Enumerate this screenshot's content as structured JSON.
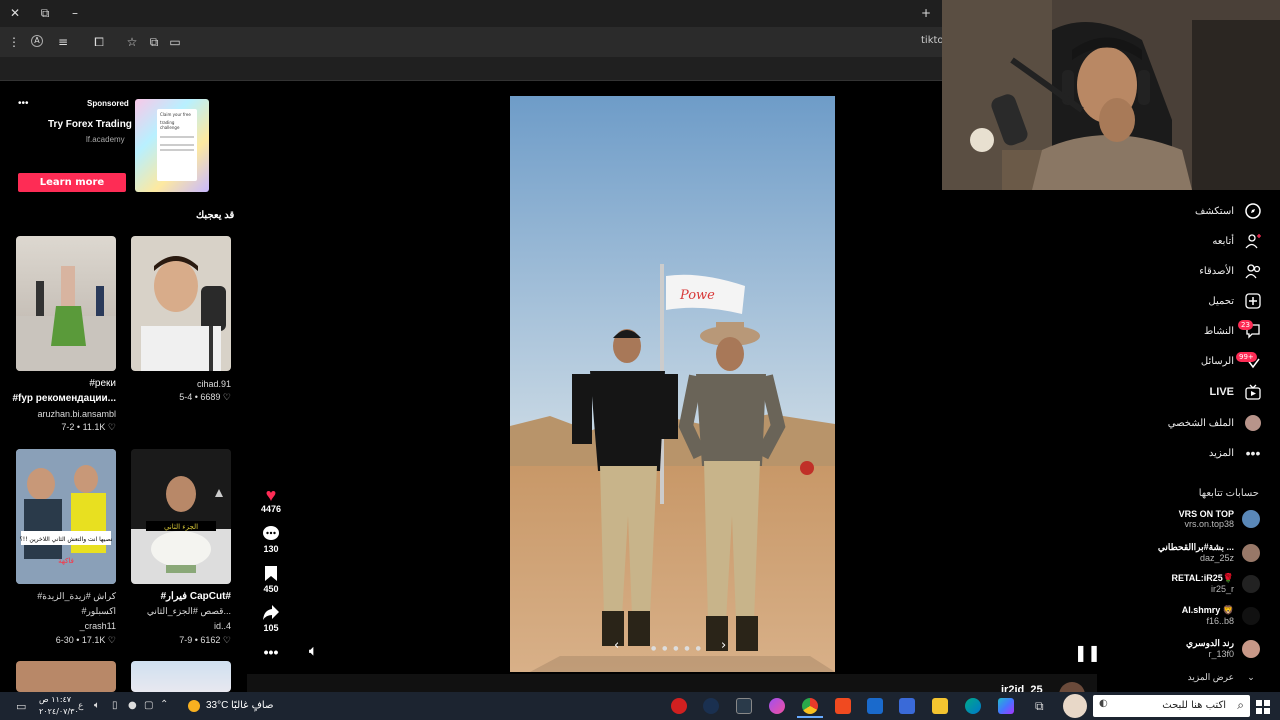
{
  "browser": {
    "url_fragment": "tiktol"
  },
  "ad": {
    "label": "Sponsored",
    "more_icon": "more-dots-icon",
    "title": "Try Forex Trading",
    "domain": "lf.academy",
    "cta": "Learn more",
    "thumb_lines": [
      "Claim your free",
      "trading challenge"
    ]
  },
  "recommendations": {
    "heading": "قد يعجبك",
    "items": [
      {
        "caption": "#реки",
        "caption2": "#fyp рекомендации...",
        "author": "aruzhan.bi.ansambl",
        "likes": "11.1K",
        "date": "7-2"
      },
      {
        "caption": "",
        "caption2": "",
        "author": "cihad.91",
        "likes": "6689",
        "date": "5-4"
      },
      {
        "caption": "#كراش #زيدة_الزيدة",
        "caption2": "#اكسبلور",
        "author": "_crash11",
        "likes": "17.1K",
        "date": "6-30",
        "overlay": "نصيها انت والتعش الثاني اللاخرين !!؟",
        "overlay2": "فاكهة"
      },
      {
        "caption": "#فيرار CapCut#",
        "caption2": "قصص #الجزء_الثاني...",
        "author": "id..4",
        "likes": "6162",
        "date": "7-9",
        "overlay": "الجزء الثاني"
      }
    ]
  },
  "actions": {
    "likes": "4476",
    "comments": "130",
    "saves": "450",
    "shares": "105"
  },
  "video": {
    "flag_text": "Powe"
  },
  "nav": {
    "explore": "استكشف",
    "following": "أتابعه",
    "friends": "الأصدقاء",
    "upload": "تحميل",
    "activity": "النشاط",
    "activity_badge": "23",
    "messages": "الرسائل",
    "messages_badge": "99+",
    "live": "LIVE",
    "profile": "الملف الشخصي",
    "more": "المزيد"
  },
  "following_accounts": {
    "heading": "حسابات تتابعها",
    "items": [
      {
        "name": "VRS ON TOP",
        "handle": "vrs.on.top38"
      },
      {
        "name": "بشة#براالقحطاني ...",
        "handle": "daz_25z"
      },
      {
        "name": "RETAL:iR25🌹",
        "handle": "ir25_r"
      },
      {
        "name": "Al.shmry 🦁",
        "handle": "f16..b8"
      },
      {
        "name": "رند الدوسري",
        "handle": "r_13f0"
      }
    ],
    "show_more": "عرض المزيد"
  },
  "bottom_user": "ir2id_25",
  "taskbar": {
    "search_placeholder": "اكتب هنا للبحث",
    "weather": "33°C",
    "weather_desc": "صافٍ غالبًا",
    "time": "١١:٤٧ ص",
    "date": "٢٠٢٤/٠٧/٣٠",
    "lang": "ع"
  }
}
